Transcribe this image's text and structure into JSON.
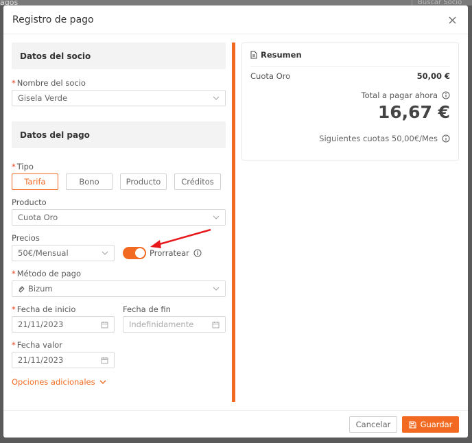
{
  "background": {
    "left_fragment": "agos",
    "search_placeholder": "Buscar Socio"
  },
  "modal": {
    "title": "Registro de pago"
  },
  "sections": {
    "member": "Datos del socio",
    "payment": "Datos del pago"
  },
  "member_name": {
    "label": "Nombre del socio",
    "value": "Gisela Verde"
  },
  "type": {
    "label": "Tipo",
    "options": [
      "Tarifa",
      "Bono",
      "Producto",
      "Créditos"
    ],
    "selected": "Tarifa"
  },
  "product": {
    "label": "Producto",
    "value": "Cuota Oro"
  },
  "prices": {
    "label": "Precios",
    "value": "50€/Mensual",
    "prorate_label": "Prorratear",
    "prorate_on": true
  },
  "payment_method": {
    "label": "Método de pago",
    "value": "Bizum"
  },
  "start_date": {
    "label": "Fecha de inicio",
    "value": "21/11/2023"
  },
  "end_date": {
    "label": "Fecha de fin",
    "placeholder": "Indefinidamente"
  },
  "value_date": {
    "label": "Fecha valor",
    "value": "21/11/2023"
  },
  "additional_options": "Opciones adicionales",
  "summary": {
    "title": "Resumen",
    "item_name": "Cuota Oro",
    "item_price": "50,00 €",
    "total_label": "Total a pagar ahora",
    "total_amount": "16,67 €",
    "next_fees": "Siguientes cuotas 50,00€/Mes"
  },
  "footer": {
    "cancel": "Cancelar",
    "save": "Guardar"
  },
  "colors": {
    "accent": "#f26a21",
    "required": "#e8401c",
    "annotation_arrow": "#e8191c"
  }
}
